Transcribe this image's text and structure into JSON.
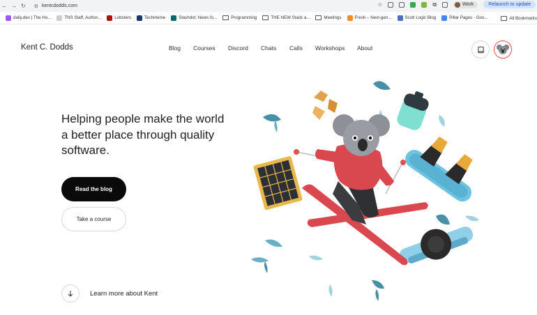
{
  "browser": {
    "url": "kentcdodds.com",
    "profile_label": "Work",
    "relaunch_label": "Relaunch to update",
    "extension_colors": [
      "#5f6368",
      "#5f6368",
      "#34a853",
      "#7cb342",
      "#5f6368",
      "#5f6368"
    ]
  },
  "bookmarks": {
    "items": [
      {
        "label": "daily.dev | The Ho...",
        "kind": "favicon",
        "color": "#9b59f5"
      },
      {
        "label": "TNS Staff, Author...",
        "kind": "favicon",
        "color": "#cccccc"
      },
      {
        "label": "Lobsters",
        "kind": "favicon",
        "color": "#ac130d"
      },
      {
        "label": "Techmeme",
        "kind": "favicon",
        "color": "#1a3a6e"
      },
      {
        "label": "Slashdot: News fo...",
        "kind": "favicon",
        "color": "#006666"
      },
      {
        "label": "Programming",
        "kind": "folder"
      },
      {
        "label": "THE NEW Stack a...",
        "kind": "folder"
      },
      {
        "label": "Meetings",
        "kind": "folder"
      },
      {
        "label": "Fresh – Next-gen...",
        "kind": "favicon",
        "color": "#f28b30"
      },
      {
        "label": "Scott Logic Blog",
        "kind": "favicon",
        "color": "#4a6fb5"
      },
      {
        "label": "Pillar Pages - Goo...",
        "kind": "favicon",
        "color": "#4285f4"
      }
    ],
    "more_label": "»",
    "all_label": "All Bookmarks"
  },
  "header": {
    "brand": "Kent C. Dodds",
    "nav": [
      "Blog",
      "Courses",
      "Discord",
      "Chats",
      "Calls",
      "Workshops",
      "About"
    ]
  },
  "hero": {
    "title": "Helping people make the world a better place through quality software.",
    "primary_button": "Read the blog",
    "secondary_button": "Take a course",
    "learn_more": "Learn more about Kent"
  },
  "colors": {
    "accent_avatar_ring": "#e05252",
    "primary_button_bg": "#0a0a0a",
    "ski_red": "#d9484f",
    "leaf_teal": "#4a8fa8"
  }
}
